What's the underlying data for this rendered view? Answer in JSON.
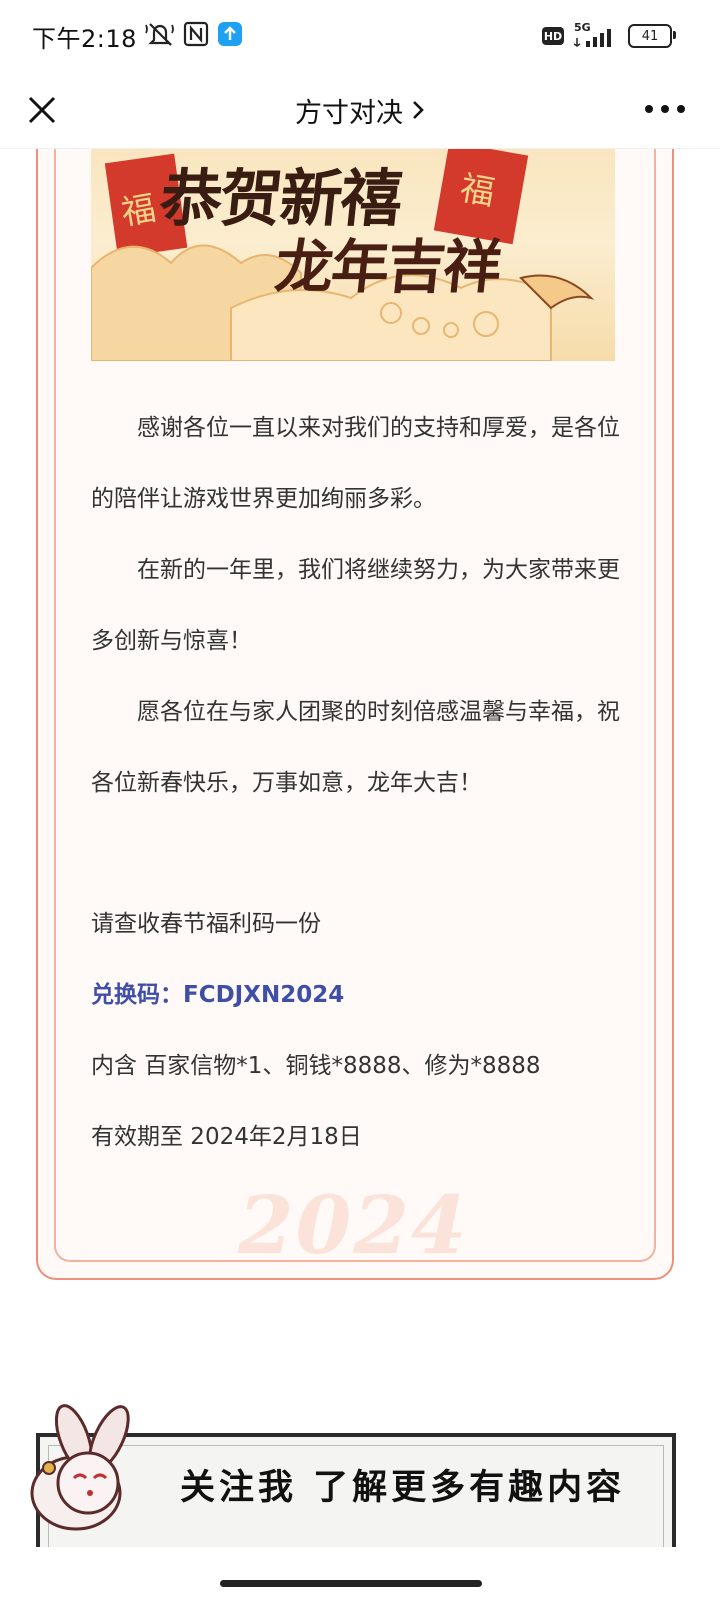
{
  "status_bar": {
    "time": "下午2:18",
    "network": "5G",
    "hd_badge": "HD",
    "battery": "41",
    "icons": [
      "mute-icon",
      "nfc-icon",
      "upload-app-icon",
      "signal-icon",
      "battery-icon"
    ]
  },
  "nav": {
    "title": "方寸对决",
    "close_icon": "close-icon",
    "more_icon": "more-icon"
  },
  "banner": {
    "line1": "恭贺新禧",
    "line2": "龙年吉祥",
    "fu": "福"
  },
  "article": {
    "paragraphs": [
      "感谢各位一直以来对我们的支持和厚爱，是各位的陪伴让游戏世界更加绚丽多彩。",
      "在新的一年里，我们将继续努力，为大家带来更多创新与惊喜！",
      "愿各位在与家人团聚的时刻倍感温馨与幸福，祝各位新春快乐，万事如意，龙年大吉！"
    ],
    "gift_intro": "请查收春节福利码一份",
    "code_line": "兑换码：FCDJXN2024",
    "contents_line": "内含 百家信物*1、铜钱*8888、修为*8888",
    "expiry_line": "有效期至 2024年2月18日",
    "watermark": "2024"
  },
  "follow_banner": {
    "text": "关注我 了解更多有趣内容"
  },
  "colors": {
    "frame_outer": "#ef8e7a",
    "frame_inner": "#f3b1a2",
    "code_text": "#3f4fa8",
    "banner_bg": "#f9e6bf"
  }
}
